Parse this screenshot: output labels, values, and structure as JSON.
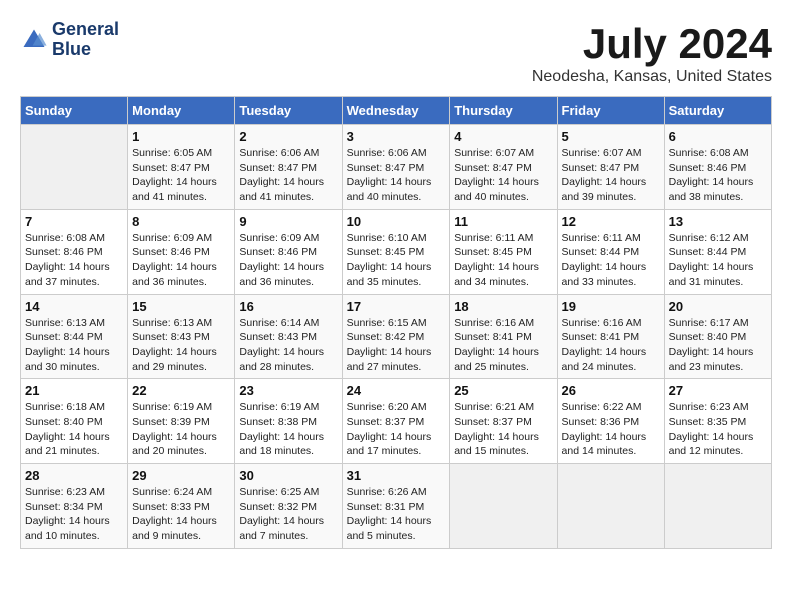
{
  "logo": {
    "line1": "General",
    "line2": "Blue"
  },
  "title": "July 2024",
  "subtitle": "Neodesha, Kansas, United States",
  "days_of_week": [
    "Sunday",
    "Monday",
    "Tuesday",
    "Wednesday",
    "Thursday",
    "Friday",
    "Saturday"
  ],
  "weeks": [
    [
      {
        "day": "",
        "sunrise": "",
        "sunset": "",
        "daylight": ""
      },
      {
        "day": "1",
        "sunrise": "Sunrise: 6:05 AM",
        "sunset": "Sunset: 8:47 PM",
        "daylight": "Daylight: 14 hours and 41 minutes."
      },
      {
        "day": "2",
        "sunrise": "Sunrise: 6:06 AM",
        "sunset": "Sunset: 8:47 PM",
        "daylight": "Daylight: 14 hours and 41 minutes."
      },
      {
        "day": "3",
        "sunrise": "Sunrise: 6:06 AM",
        "sunset": "Sunset: 8:47 PM",
        "daylight": "Daylight: 14 hours and 40 minutes."
      },
      {
        "day": "4",
        "sunrise": "Sunrise: 6:07 AM",
        "sunset": "Sunset: 8:47 PM",
        "daylight": "Daylight: 14 hours and 40 minutes."
      },
      {
        "day": "5",
        "sunrise": "Sunrise: 6:07 AM",
        "sunset": "Sunset: 8:47 PM",
        "daylight": "Daylight: 14 hours and 39 minutes."
      },
      {
        "day": "6",
        "sunrise": "Sunrise: 6:08 AM",
        "sunset": "Sunset: 8:46 PM",
        "daylight": "Daylight: 14 hours and 38 minutes."
      }
    ],
    [
      {
        "day": "7",
        "sunrise": "Sunrise: 6:08 AM",
        "sunset": "Sunset: 8:46 PM",
        "daylight": "Daylight: 14 hours and 37 minutes."
      },
      {
        "day": "8",
        "sunrise": "Sunrise: 6:09 AM",
        "sunset": "Sunset: 8:46 PM",
        "daylight": "Daylight: 14 hours and 36 minutes."
      },
      {
        "day": "9",
        "sunrise": "Sunrise: 6:09 AM",
        "sunset": "Sunset: 8:46 PM",
        "daylight": "Daylight: 14 hours and 36 minutes."
      },
      {
        "day": "10",
        "sunrise": "Sunrise: 6:10 AM",
        "sunset": "Sunset: 8:45 PM",
        "daylight": "Daylight: 14 hours and 35 minutes."
      },
      {
        "day": "11",
        "sunrise": "Sunrise: 6:11 AM",
        "sunset": "Sunset: 8:45 PM",
        "daylight": "Daylight: 14 hours and 34 minutes."
      },
      {
        "day": "12",
        "sunrise": "Sunrise: 6:11 AM",
        "sunset": "Sunset: 8:44 PM",
        "daylight": "Daylight: 14 hours and 33 minutes."
      },
      {
        "day": "13",
        "sunrise": "Sunrise: 6:12 AM",
        "sunset": "Sunset: 8:44 PM",
        "daylight": "Daylight: 14 hours and 31 minutes."
      }
    ],
    [
      {
        "day": "14",
        "sunrise": "Sunrise: 6:13 AM",
        "sunset": "Sunset: 8:44 PM",
        "daylight": "Daylight: 14 hours and 30 minutes."
      },
      {
        "day": "15",
        "sunrise": "Sunrise: 6:13 AM",
        "sunset": "Sunset: 8:43 PM",
        "daylight": "Daylight: 14 hours and 29 minutes."
      },
      {
        "day": "16",
        "sunrise": "Sunrise: 6:14 AM",
        "sunset": "Sunset: 8:43 PM",
        "daylight": "Daylight: 14 hours and 28 minutes."
      },
      {
        "day": "17",
        "sunrise": "Sunrise: 6:15 AM",
        "sunset": "Sunset: 8:42 PM",
        "daylight": "Daylight: 14 hours and 27 minutes."
      },
      {
        "day": "18",
        "sunrise": "Sunrise: 6:16 AM",
        "sunset": "Sunset: 8:41 PM",
        "daylight": "Daylight: 14 hours and 25 minutes."
      },
      {
        "day": "19",
        "sunrise": "Sunrise: 6:16 AM",
        "sunset": "Sunset: 8:41 PM",
        "daylight": "Daylight: 14 hours and 24 minutes."
      },
      {
        "day": "20",
        "sunrise": "Sunrise: 6:17 AM",
        "sunset": "Sunset: 8:40 PM",
        "daylight": "Daylight: 14 hours and 23 minutes."
      }
    ],
    [
      {
        "day": "21",
        "sunrise": "Sunrise: 6:18 AM",
        "sunset": "Sunset: 8:40 PM",
        "daylight": "Daylight: 14 hours and 21 minutes."
      },
      {
        "day": "22",
        "sunrise": "Sunrise: 6:19 AM",
        "sunset": "Sunset: 8:39 PM",
        "daylight": "Daylight: 14 hours and 20 minutes."
      },
      {
        "day": "23",
        "sunrise": "Sunrise: 6:19 AM",
        "sunset": "Sunset: 8:38 PM",
        "daylight": "Daylight: 14 hours and 18 minutes."
      },
      {
        "day": "24",
        "sunrise": "Sunrise: 6:20 AM",
        "sunset": "Sunset: 8:37 PM",
        "daylight": "Daylight: 14 hours and 17 minutes."
      },
      {
        "day": "25",
        "sunrise": "Sunrise: 6:21 AM",
        "sunset": "Sunset: 8:37 PM",
        "daylight": "Daylight: 14 hours and 15 minutes."
      },
      {
        "day": "26",
        "sunrise": "Sunrise: 6:22 AM",
        "sunset": "Sunset: 8:36 PM",
        "daylight": "Daylight: 14 hours and 14 minutes."
      },
      {
        "day": "27",
        "sunrise": "Sunrise: 6:23 AM",
        "sunset": "Sunset: 8:35 PM",
        "daylight": "Daylight: 14 hours and 12 minutes."
      }
    ],
    [
      {
        "day": "28",
        "sunrise": "Sunrise: 6:23 AM",
        "sunset": "Sunset: 8:34 PM",
        "daylight": "Daylight: 14 hours and 10 minutes."
      },
      {
        "day": "29",
        "sunrise": "Sunrise: 6:24 AM",
        "sunset": "Sunset: 8:33 PM",
        "daylight": "Daylight: 14 hours and 9 minutes."
      },
      {
        "day": "30",
        "sunrise": "Sunrise: 6:25 AM",
        "sunset": "Sunset: 8:32 PM",
        "daylight": "Daylight: 14 hours and 7 minutes."
      },
      {
        "day": "31",
        "sunrise": "Sunrise: 6:26 AM",
        "sunset": "Sunset: 8:31 PM",
        "daylight": "Daylight: 14 hours and 5 minutes."
      },
      {
        "day": "",
        "sunrise": "",
        "sunset": "",
        "daylight": ""
      },
      {
        "day": "",
        "sunrise": "",
        "sunset": "",
        "daylight": ""
      },
      {
        "day": "",
        "sunrise": "",
        "sunset": "",
        "daylight": ""
      }
    ]
  ]
}
